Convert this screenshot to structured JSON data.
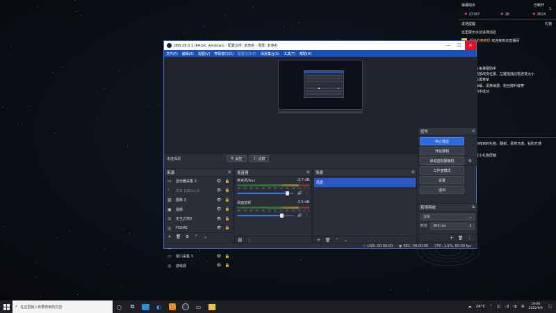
{
  "overlay": {
    "header": {
      "left": "弹幕助手",
      "right": "已断开"
    },
    "likes": "1",
    "stats": [
      {
        "icon": "♥",
        "value": "23387"
      },
      {
        "icon": "♥",
        "value": "28"
      },
      {
        "icon": "♥",
        "value": "3824"
      }
    ],
    "tabs": {
      "left": "进场提醒",
      "right": "礼物"
    },
    "messages": [
      "这里展示水友进场消息",
      "",
      "欢迎使用斗鱼弹幕助手",
      "左键拖拽顶部改变位置，左键拖拽边框改变大小",
      "右上角有设置菜单",
      "这里展示弹幕、贵族续费、粉丝牌升级等",
      "添加弹幕助手成功",
      "这里展示你收到的礼物、酬谢、贵族开通、钻粉开通",
      "点螺帽设置小礼物屏蔽"
    ],
    "welcome": "欢迎来到本直播间",
    "welcome_user": "超级的嘀嘀怪"
  },
  "obs": {
    "title": "OBS 28.0.1 (64-bit, windows) - 配置文件: 未命名 - 场景: 未命名",
    "menu": [
      {
        "label": "文件(F)",
        "dim": false
      },
      {
        "label": "编辑(E)",
        "dim": false
      },
      {
        "label": "视图(V)",
        "dim": false
      },
      {
        "label": "停靠窗口(D)",
        "dim": false
      },
      {
        "label": "配置文件(P)",
        "dim": true
      },
      {
        "label": "场景集合(S)",
        "dim": false
      },
      {
        "label": "工具(T)",
        "dim": false
      },
      {
        "label": "帮助(H)",
        "dim": false
      }
    ],
    "no_scene": "未选择源",
    "properties_btn": "属性",
    "filters_btn": "滤镜",
    "sources_title": "来源",
    "sources": [
      {
        "icon": "▭",
        "label": "显示器采集 2",
        "dim": false
      },
      {
        "icon": "ᵀ",
        "label": "文本 (GDI+) 2",
        "dim": true
      },
      {
        "icon": "▨",
        "label": "图像 3",
        "dim": false
      },
      {
        "icon": "▣",
        "label": "视频",
        "dim": false
      },
      {
        "icon": "◎",
        "label": "无主之地3",
        "dim": false
      },
      {
        "icon": "◎",
        "label": "FUSHE",
        "dim": false
      },
      {
        "icon": "◎",
        "label": "游戏源 3",
        "dim": false
      },
      {
        "icon": "▨",
        "label": "IMG_20220906877...",
        "dim": true
      },
      {
        "icon": "▭",
        "label": "窗口采集 3",
        "dim": false
      },
      {
        "icon": "◎",
        "label": "游戏源",
        "dim": false
      }
    ],
    "mixer_title": "混音器",
    "mixer": [
      {
        "name": "麦克风/Aux",
        "db": "-2.7 dB",
        "fill": 0.88
      },
      {
        "name": "桌面音频",
        "db": "-5.5 dB",
        "fill": 0.78
      }
    ],
    "meter_scale": [
      "-60",
      "-55",
      "-50",
      "-45",
      "-40",
      "-35",
      "-30",
      "-25",
      "-20",
      "-15",
      "-10",
      "-5",
      "0"
    ],
    "scenes_title": "场景",
    "scenes": [
      "场景"
    ],
    "controls_title": "控件",
    "controls": [
      {
        "label": "停止播送",
        "active": true
      },
      {
        "label": "开始录制",
        "active": false
      },
      {
        "label": "启动虚拟摄像机",
        "active": false
      },
      {
        "label": "工作室模式",
        "active": false
      },
      {
        "label": "设置",
        "active": false
      },
      {
        "label": "退出",
        "active": false
      }
    ],
    "transitions_title": "转场特效",
    "transition_type": "淡化",
    "duration_label": "时长",
    "duration_value": "300 ms",
    "status": {
      "live": "LIVE: 00:00:00",
      "rec": "REC: 00:00:00",
      "cpu": "CPU: 1.5%, 60.00 fps"
    }
  },
  "taskbar": {
    "search_placeholder": "在这里输入你要搜索的内容",
    "weather": "24°C",
    "ime": "中",
    "time": "19:06",
    "date": "2022/9/9"
  }
}
